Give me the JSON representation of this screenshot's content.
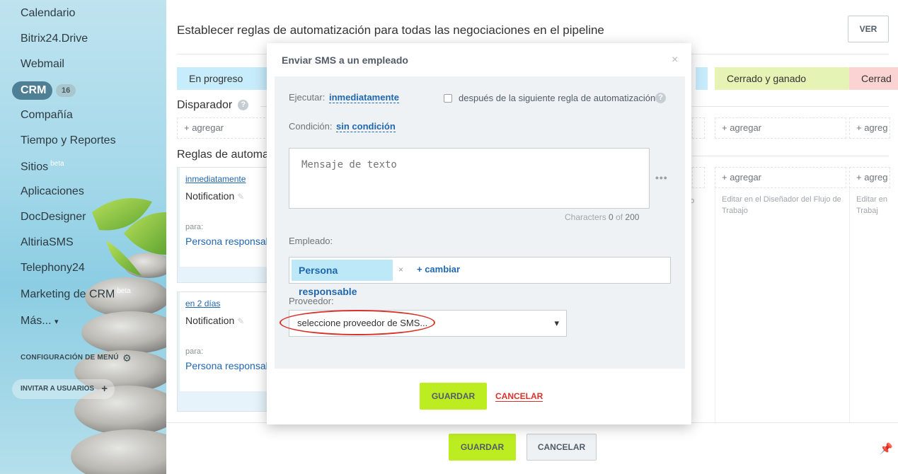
{
  "sidebar": {
    "items": [
      {
        "label": "Calendario"
      },
      {
        "label": "Bitrix24.Drive"
      },
      {
        "label": "Webmail"
      },
      {
        "label": "CRM",
        "badge": "16"
      },
      {
        "label": "Compañía"
      },
      {
        "label": "Tiempo y Reportes"
      },
      {
        "label": "Sitios",
        "sup": "beta"
      },
      {
        "label": "Aplicaciones"
      },
      {
        "label": "DocDesigner"
      },
      {
        "label": "AltiriaSMS"
      },
      {
        "label": "Telephony24"
      },
      {
        "label": "Marketing de CRM",
        "sup": "beta"
      },
      {
        "label": "Más...",
        "chevron": "▾"
      }
    ],
    "config_label": "CONFIGURACIÓN DE MENÚ",
    "invite_label": "INVITAR A USUARIOS"
  },
  "main": {
    "title": "Establecer reglas de automatización para todas las negociaciones en el pipeline",
    "view_button": "VER",
    "stages": {
      "in_progress": "En progreso",
      "won": "Cerrado y ganado",
      "lost": "Cerrad"
    },
    "trigger_label": "Disparador",
    "rules_label": "Reglas de automa",
    "add_label": "+ agregar",
    "add_label_cut": "+ agreg",
    "rules": [
      {
        "when": "inmediatamente",
        "title": "Notification",
        "para": "para:",
        "person": "Persona responsab"
      },
      {
        "when": "en 2 días",
        "title": "Notification",
        "para": "para:",
        "person": "Persona responsab"
      }
    ],
    "edit_hint": "Editar en el Diseñador del Flujo de Trabajo",
    "edit_hint_cut": "Editar en Trabaj",
    "fragment_o": "o",
    "save_button": "GUARDAR",
    "cancel_button": "CANCELAR"
  },
  "dialog": {
    "title": "Enviar SMS a un empleado",
    "execute_label": "Ejecutar:",
    "execute_value": "inmediatamente",
    "after_rule_label": "después de la siguiente regla de automatización",
    "condition_label": "Condición:",
    "condition_value": "sin condición",
    "message_placeholder": "Mensaje de texto",
    "chars_label": "Characters",
    "chars_count": "0",
    "chars_of": "of",
    "chars_max": "200",
    "employee_label": "Empleado:",
    "employee_tag": "Persona responsable",
    "change_label": "+ cambiar",
    "provider_label": "Proveedor:",
    "provider_value": "seleccione proveedor de SMS...",
    "save_button": "GUARDAR",
    "cancel_button": "CANCELAR"
  },
  "colors": {
    "accent_green": "#bbed21",
    "link_blue": "#2067b0",
    "cancel_red": "#d9322b",
    "stage_progress": "#c7ecfb",
    "stage_won": "#e5f3b5",
    "stage_lost": "#fcd3d3"
  }
}
